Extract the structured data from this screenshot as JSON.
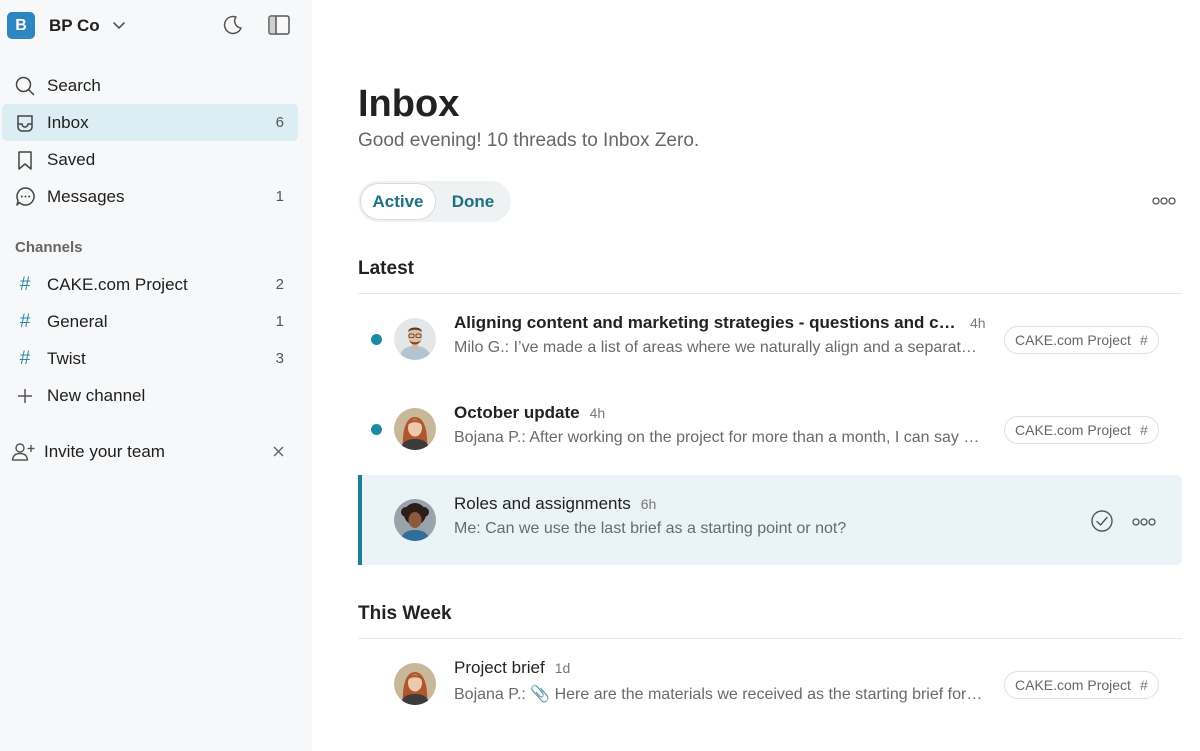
{
  "workspace": {
    "initial": "B",
    "name": "BP Co"
  },
  "nav": [
    {
      "label": "Search",
      "count": ""
    },
    {
      "label": "Inbox",
      "count": "6"
    },
    {
      "label": "Saved",
      "count": ""
    },
    {
      "label": "Messages",
      "count": "1"
    }
  ],
  "channels_header": "Channels",
  "channels": [
    {
      "label": "CAKE.com Project",
      "count": "2"
    },
    {
      "label": "General",
      "count": "1"
    },
    {
      "label": "Twist",
      "count": "3"
    }
  ],
  "new_channel": "New channel",
  "invite": "Invite your team",
  "inbox": {
    "title": "Inbox",
    "subtitle": "Good evening! 10 threads to Inbox Zero.",
    "tabs": [
      "Active",
      "Done"
    ]
  },
  "groups": {
    "latest": "Latest",
    "this_week": "This Week"
  },
  "threads": [
    {
      "title": "Aligning content and marketing strategies - questions and co...",
      "time": "4h",
      "snippet": "Milo G.: I’ve made a list of areas where we naturally align and a separate ...",
      "tag": "CAKE.com Project",
      "tag_hash": "#"
    },
    {
      "title": "October update",
      "time": "4h",
      "snippet": "Bojana P.: After working on the project for more than a month, I can say w...",
      "tag": "CAKE.com Project",
      "tag_hash": "#"
    },
    {
      "title": "Roles and assignments",
      "time": "6h",
      "snippet": "Me: Can we use the last brief as a starting point or not?"
    },
    {
      "title": "Project brief",
      "time": "1d",
      "snippet": "Bojana P.: 📎 Here are the materials we received as the starting brief for t...",
      "tag": "CAKE.com Project",
      "tag_hash": "#"
    }
  ],
  "colors": {
    "accent": "#1b8aa3",
    "workspace": "#2e86c1",
    "active_nav": "#dcedf3",
    "selected_thread": "#eaf3f6"
  }
}
